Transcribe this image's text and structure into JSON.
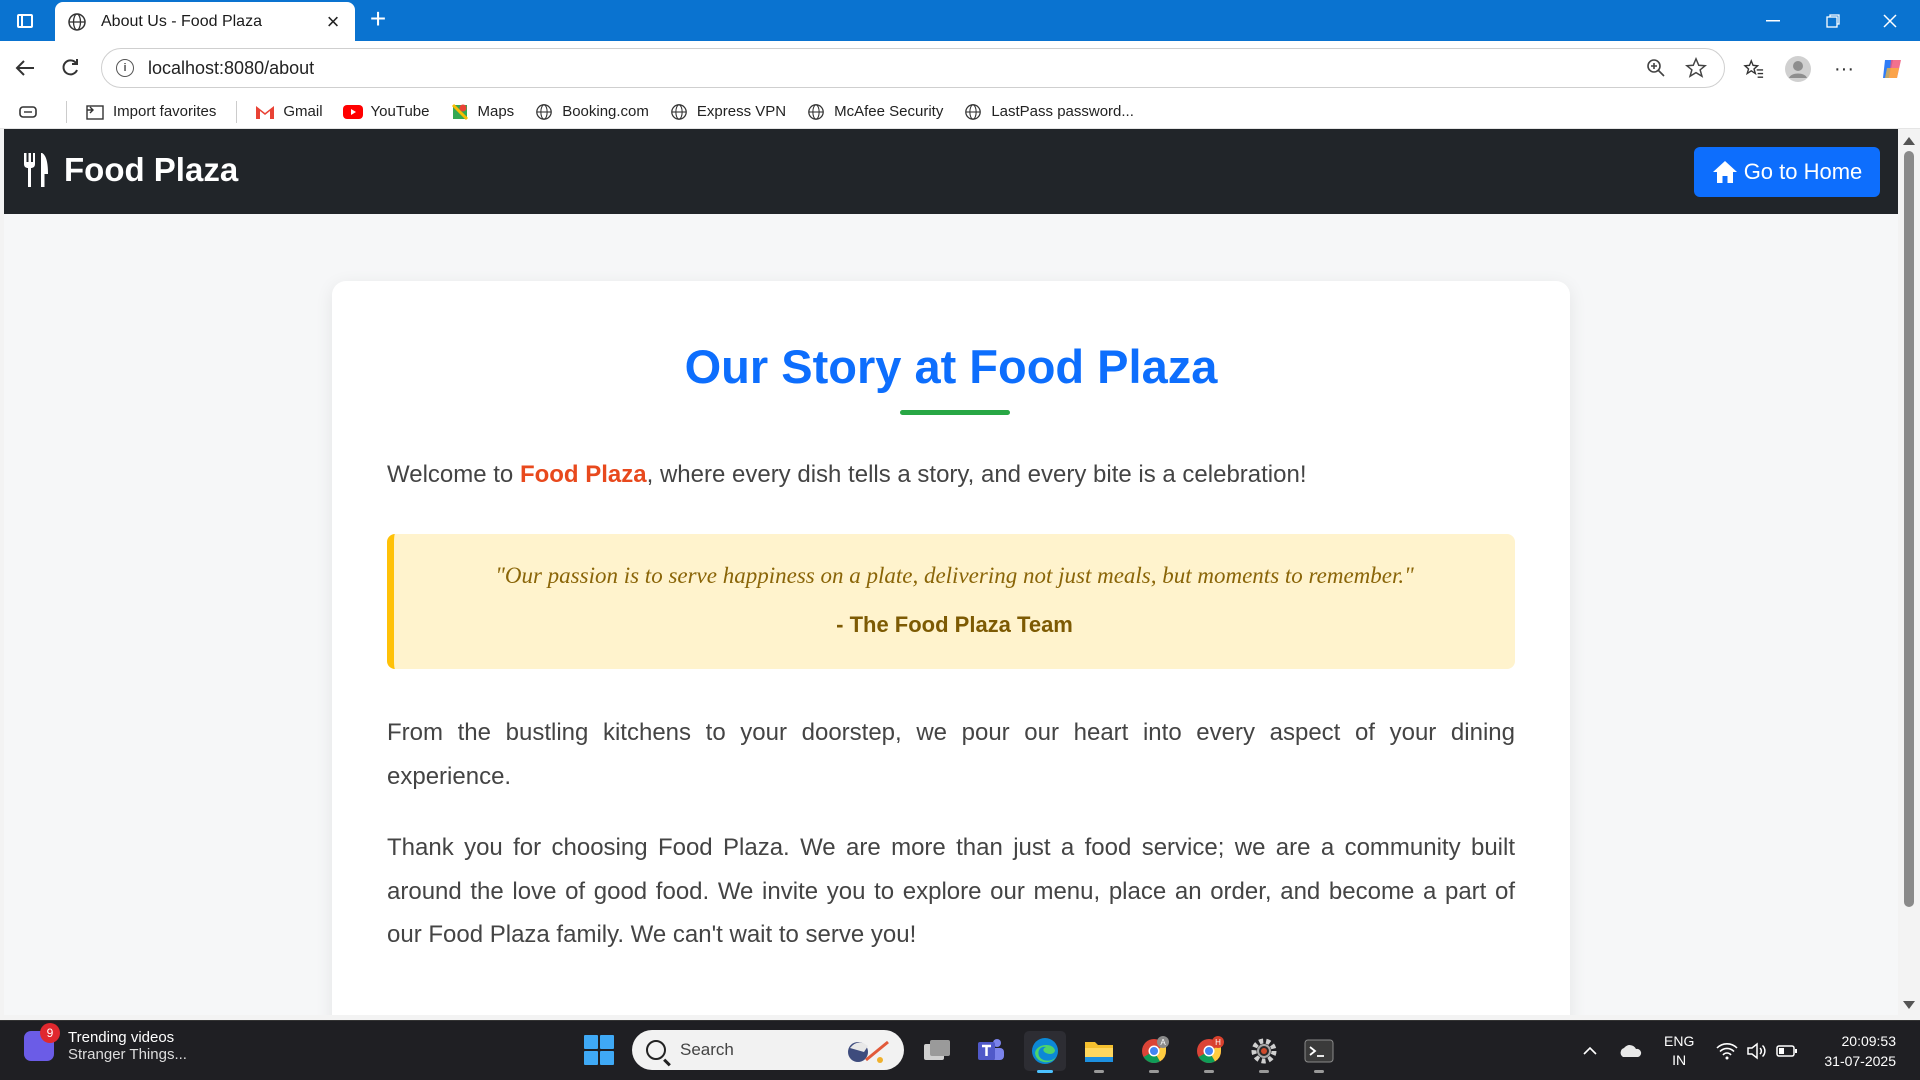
{
  "browser": {
    "tab_title": "About Us - Food Plaza",
    "url": "localhost:8080/about",
    "favorites": [
      {
        "label": "Import favorites",
        "icon": "import-icon"
      },
      {
        "label": "Gmail",
        "icon": "gmail-icon"
      },
      {
        "label": "YouTube",
        "icon": "youtube-icon"
      },
      {
        "label": "Maps",
        "icon": "maps-icon"
      },
      {
        "label": "Booking.com",
        "icon": "globe-icon"
      },
      {
        "label": "Express VPN",
        "icon": "globe-icon"
      },
      {
        "label": "McAfee Security",
        "icon": "globe-icon"
      },
      {
        "label": "LastPass password...",
        "icon": "globe-icon"
      }
    ]
  },
  "site": {
    "brand": "Food Plaza",
    "home_button": "Go to Home",
    "title": "Our Story at Food Plaza",
    "intro_before": "Welcome to ",
    "intro_highlight": "Food Plaza",
    "intro_after": ", where every dish tells a story, and every bite is a celebration!",
    "quote": "\"Our passion is to serve happiness on a plate, delivering not just meals, but moments to remember.\"",
    "quote_author": "- The Food Plaza Team",
    "paragraph1": "From the bustling kitchens to your doorstep, we pour our heart into every aspect of your dining experience.",
    "paragraph2": "Thank you for choosing Food Plaza. We are more than just a food service; we are a community built around the love of good food. We invite you to explore our menu, place an order, and become a part of our Food Plaza family. We can't wait to serve you!",
    "colors": {
      "primary": "#0d6efd",
      "accent": "#e8491d",
      "underline": "#28a745",
      "quote_bg": "#fff3cd",
      "quote_border": "#ffc107"
    }
  },
  "taskbar": {
    "widget_badge": "9",
    "widget_title": "Trending videos",
    "widget_subtitle": "Stranger Things...",
    "search_placeholder": "Search",
    "lang_1": "ENG",
    "lang_2": "IN",
    "time": "20:09:53",
    "date": "31-07-2025",
    "chrome_badge_a": "A",
    "chrome_badge_h": "H"
  }
}
